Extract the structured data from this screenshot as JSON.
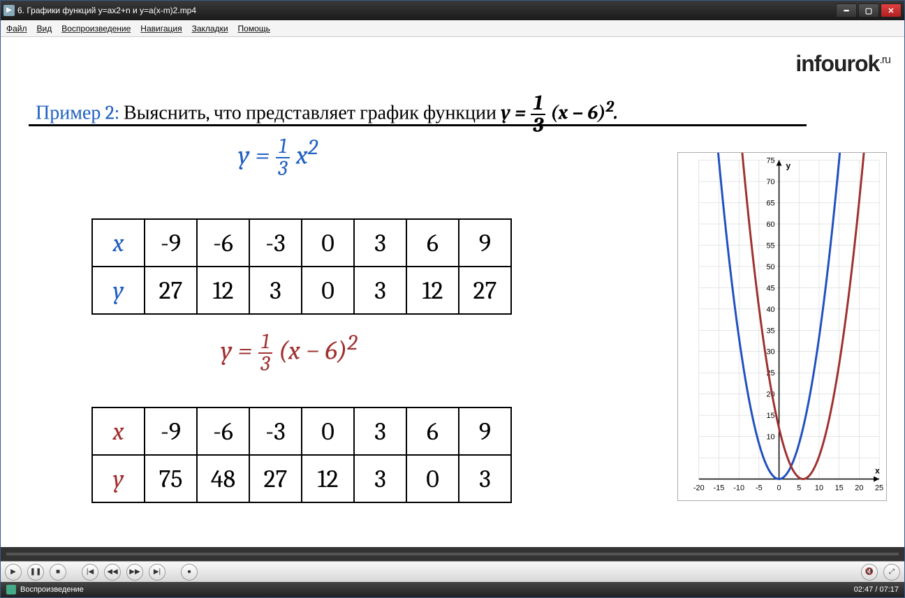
{
  "window": {
    "title": "6. Графики функций y=ax2+n и y=a(x-m)2.mp4"
  },
  "menu": {
    "file": "Файл",
    "view": "Вид",
    "play": "Воспроизведение",
    "nav": "Навигация",
    "book": "Закладки",
    "help": "Помощь"
  },
  "logo": "infourok",
  "logo_sup": ".ru",
  "heading": {
    "prefix": "Пример 2:",
    "text": " Выяснить, что представляет график функции ",
    "fn_y": "y",
    "fn_eq": " = ",
    "fn_frac_n": "1",
    "fn_frac_d": "3",
    "fn_rest": " (x − 6)",
    "fn_sup": "2",
    "dot": "."
  },
  "eq1": {
    "y": "y",
    "eq": " = ",
    "n": "1",
    "d": "3",
    "x": "x",
    "sup": "2"
  },
  "eq2": {
    "y": "y",
    "eq": " = ",
    "n": "1",
    "d": "3",
    "rest": "(x − 6)",
    "sup": "2"
  },
  "t1": {
    "xl": "x",
    "yl": "y",
    "x": [
      "-9",
      "-6",
      "-3",
      "0",
      "3",
      "6",
      "9"
    ],
    "y": [
      "27",
      "12",
      "3",
      "0",
      "3",
      "12",
      "27"
    ]
  },
  "t2": {
    "xl": "x",
    "yl": "y",
    "x": [
      "-9",
      "-6",
      "-3",
      "0",
      "3",
      "6",
      "9"
    ],
    "y": [
      "75",
      "48",
      "27",
      "12",
      "3",
      "0",
      "3"
    ]
  },
  "chart_data": {
    "type": "line",
    "xlabel": "x",
    "ylabel": "y",
    "xlim": [
      -20,
      25
    ],
    "ylim": [
      0,
      75
    ],
    "xticks": [
      -20,
      -15,
      -10,
      -5,
      0,
      5,
      10,
      15,
      20,
      25
    ],
    "yticks": [
      10,
      15,
      20,
      25,
      30,
      35,
      40,
      45,
      50,
      55,
      60,
      65,
      70,
      75
    ],
    "series": [
      {
        "name": "y = (1/3)x^2",
        "color": "#2050c0",
        "x": [
          -15,
          -12,
          -9,
          -6,
          -3,
          0,
          3,
          6,
          9,
          12,
          15
        ],
        "y": [
          75,
          48,
          27,
          12,
          3,
          0,
          3,
          12,
          27,
          48,
          75
        ]
      },
      {
        "name": "y = (1/3)(x-6)^2",
        "color": "#a03030",
        "x": [
          -9,
          -6,
          -3,
          0,
          3,
          6,
          9,
          12,
          15,
          18,
          21
        ],
        "y": [
          75,
          48,
          27,
          12,
          3,
          0,
          3,
          12,
          27,
          48,
          75
        ]
      }
    ]
  },
  "status": {
    "text": "Воспроизведение",
    "time": "02:47 / 07:17"
  }
}
